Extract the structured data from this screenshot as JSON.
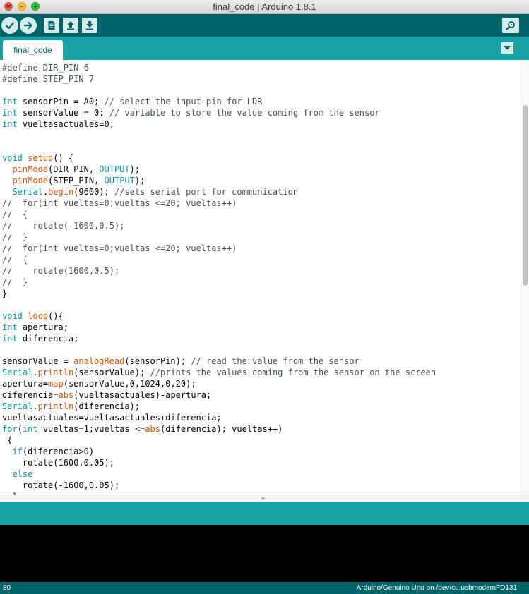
{
  "window": {
    "title": "final_code | Arduino 1.8.1"
  },
  "toolbar": {
    "buttons": [
      {
        "name": "verify",
        "icon": "checkmark-icon"
      },
      {
        "name": "upload",
        "icon": "arrow-right-icon"
      },
      {
        "name": "new",
        "icon": "document-icon"
      },
      {
        "name": "open",
        "icon": "arrow-up-icon"
      },
      {
        "name": "save",
        "icon": "arrow-down-icon"
      },
      {
        "name": "serial-monitor",
        "icon": "magnifier-icon"
      }
    ]
  },
  "tabs": [
    {
      "label": "final_code",
      "active": true
    }
  ],
  "editor": {
    "lines": [
      [
        [
          "pp",
          "#define DIR_PIN 6"
        ]
      ],
      [
        [
          "pp",
          "#define STEP_PIN 7"
        ]
      ],
      [],
      [
        [
          "kw",
          "int"
        ],
        [
          "tx",
          " sensorPin = A0; "
        ],
        [
          "cm",
          "// select the input pin for LDR"
        ]
      ],
      [
        [
          "kw",
          "int"
        ],
        [
          "tx",
          " sensorValue = 0; "
        ],
        [
          "cm",
          "// variable to store the value coming from the sensor"
        ]
      ],
      [
        [
          "kw",
          "int"
        ],
        [
          "tx",
          " vueltasactuales=0;"
        ]
      ],
      [],
      [],
      [
        [
          "kw",
          "void"
        ],
        [
          "tx",
          " "
        ],
        [
          "fn",
          "setup"
        ],
        [
          "tx",
          "() {"
        ]
      ],
      [
        [
          "tx",
          "  "
        ],
        [
          "fn",
          "pinMode"
        ],
        [
          "tx",
          "(DIR_PIN, "
        ],
        [
          "kw",
          "OUTPUT"
        ],
        [
          "tx",
          ");"
        ]
      ],
      [
        [
          "tx",
          "  "
        ],
        [
          "fn",
          "pinMode"
        ],
        [
          "tx",
          "(STEP_PIN, "
        ],
        [
          "kw",
          "OUTPUT"
        ],
        [
          "tx",
          ");"
        ]
      ],
      [
        [
          "tx",
          "  "
        ],
        [
          "kw",
          "Serial"
        ],
        [
          "tx",
          "."
        ],
        [
          "fn",
          "begin"
        ],
        [
          "tx",
          "(9600); "
        ],
        [
          "cm",
          "//sets serial port for communication"
        ]
      ],
      [
        [
          "cm",
          "//  for(int vueltas=0;vueltas <=20; vueltas++)"
        ]
      ],
      [
        [
          "cm",
          "//  {"
        ]
      ],
      [
        [
          "cm",
          "//    rotate(-1600,0.5);"
        ]
      ],
      [
        [
          "cm",
          "//  }"
        ]
      ],
      [
        [
          "cm",
          "//  for(int vueltas=0;vueltas <=20; vueltas++)"
        ]
      ],
      [
        [
          "cm",
          "//  {"
        ]
      ],
      [
        [
          "cm",
          "//    rotate(1600,0.5);"
        ]
      ],
      [
        [
          "cm",
          "//  }"
        ]
      ],
      [
        [
          "tx",
          "}"
        ]
      ],
      [],
      [
        [
          "kw",
          "void"
        ],
        [
          "tx",
          " "
        ],
        [
          "fn",
          "loop"
        ],
        [
          "tx",
          "(){"
        ]
      ],
      [
        [
          "kw",
          "int"
        ],
        [
          "tx",
          " apertura;"
        ]
      ],
      [
        [
          "kw",
          "int"
        ],
        [
          "tx",
          " diferencia;"
        ]
      ],
      [],
      [
        [
          "tx",
          "sensorValue = "
        ],
        [
          "fn",
          "analogRead"
        ],
        [
          "tx",
          "(sensorPin); "
        ],
        [
          "cm",
          "// read the value from the sensor"
        ]
      ],
      [
        [
          "kw",
          "Serial"
        ],
        [
          "tx",
          "."
        ],
        [
          "fn",
          "println"
        ],
        [
          "tx",
          "(sensorValue); "
        ],
        [
          "cm",
          "//prints the values coming from the sensor on the screen"
        ]
      ],
      [
        [
          "tx",
          "apertura="
        ],
        [
          "fn",
          "map"
        ],
        [
          "tx",
          "(sensorValue,0,1024,0,20);"
        ]
      ],
      [
        [
          "tx",
          "diferencia="
        ],
        [
          "fn",
          "abs"
        ],
        [
          "tx",
          "(vueltasactuales)-apertura;"
        ]
      ],
      [
        [
          "kw",
          "Serial"
        ],
        [
          "tx",
          "."
        ],
        [
          "fn",
          "println"
        ],
        [
          "tx",
          "(diferencia);"
        ]
      ],
      [
        [
          "tx",
          "vueltasactuales=vueltasactuales+diferencia;"
        ]
      ],
      [
        [
          "kw",
          "for"
        ],
        [
          "tx",
          "("
        ],
        [
          "kw",
          "int"
        ],
        [
          "tx",
          " vueltas=1;vueltas <="
        ],
        [
          "fn",
          "abs"
        ],
        [
          "tx",
          "(diferencia); vueltas++)"
        ]
      ],
      [
        [
          "tx",
          " {"
        ]
      ],
      [
        [
          "tx",
          "  "
        ],
        [
          "kw",
          "if"
        ],
        [
          "tx",
          "(diferencia>0)"
        ]
      ],
      [
        [
          "tx",
          "    rotate(1600,0.05);"
        ]
      ],
      [
        [
          "tx",
          "  "
        ],
        [
          "kw",
          "else"
        ]
      ],
      [
        [
          "tx",
          "    rotate(-1600,0.05);"
        ]
      ],
      [
        [
          "tx",
          "  }"
        ]
      ]
    ]
  },
  "status": {
    "line_number": "80",
    "board": "Arduino/Genuino Uno on /dev/cu.usbmodemFD131"
  },
  "colors": {
    "toolbar": "#006468",
    "tabbar": "#17a1a5",
    "keyword": "#00979c",
    "function": "#d35400",
    "comment": "#434f54"
  }
}
